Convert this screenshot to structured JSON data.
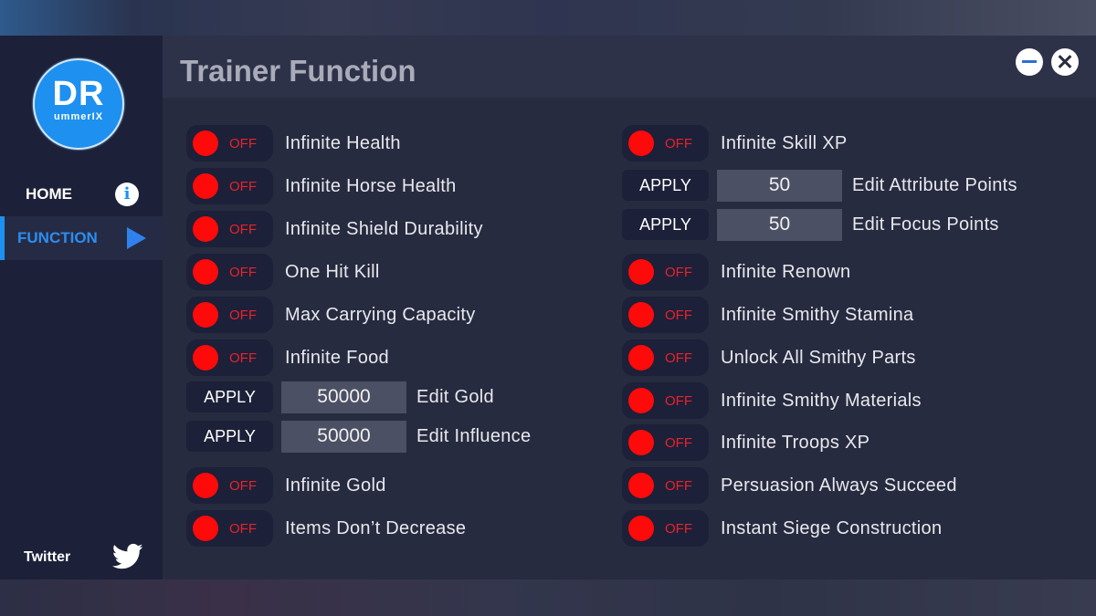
{
  "window": {
    "title": "Trainer Function",
    "minimize_icon": "minimize-icon",
    "close_icon": "close-icon"
  },
  "sidebar": {
    "logo": {
      "big": "DR",
      "small": "ummerIX"
    },
    "items": [
      {
        "label": "HOME",
        "icon": "info-icon",
        "icon_glyph": "i",
        "active": false
      },
      {
        "label": "FUNCTION",
        "icon": "play-icon",
        "active": true
      }
    ],
    "footer": {
      "label": "Twitter",
      "icon": "twitter-icon"
    }
  },
  "colors": {
    "accent": "#1e90f0",
    "toggle_off_knob": "#ff0a0a",
    "toggle_off_text": "#e8232b",
    "panel_bg": "#272b3f",
    "sidebar_bg": "#1c2038"
  },
  "left_column": [
    {
      "type": "toggle",
      "state": "OFF",
      "label": "Infinite Health"
    },
    {
      "type": "toggle",
      "state": "OFF",
      "label": "Infinite Horse Health"
    },
    {
      "type": "toggle",
      "state": "OFF",
      "label": "Infinite Shield Durability"
    },
    {
      "type": "toggle",
      "state": "OFF",
      "label": "One Hit Kill"
    },
    {
      "type": "toggle",
      "state": "OFF",
      "label": "Max Carrying Capacity"
    },
    {
      "type": "toggle",
      "state": "OFF",
      "label": "Infinite Food"
    },
    {
      "type": "edit",
      "button": "APPLY",
      "value": "50000",
      "label": "Edit Gold"
    },
    {
      "type": "edit",
      "button": "APPLY",
      "value": "50000",
      "label": "Edit Influence"
    },
    {
      "type": "toggle",
      "state": "OFF",
      "label": "Infinite Gold"
    },
    {
      "type": "toggle",
      "state": "OFF",
      "label": "Items Don’t Decrease"
    }
  ],
  "right_column": [
    {
      "type": "toggle",
      "state": "OFF",
      "label": "Infinite Skill XP"
    },
    {
      "type": "edit",
      "button": "APPLY",
      "value": "50",
      "label": "Edit Attribute Points"
    },
    {
      "type": "edit",
      "button": "APPLY",
      "value": "50",
      "label": "Edit Focus Points"
    },
    {
      "type": "toggle",
      "state": "OFF",
      "label": "Infinite Renown"
    },
    {
      "type": "toggle",
      "state": "OFF",
      "label": "Infinite Smithy Stamina"
    },
    {
      "type": "toggle",
      "state": "OFF",
      "label": "Unlock All Smithy Parts"
    },
    {
      "type": "toggle",
      "state": "OFF",
      "label": "Infinite Smithy Materials"
    },
    {
      "type": "toggle",
      "state": "OFF",
      "label": "Infinite Troops XP"
    },
    {
      "type": "toggle",
      "state": "OFF",
      "label": "Persuasion Always Succeed"
    },
    {
      "type": "toggle",
      "state": "OFF",
      "label": "Instant Siege Construction"
    }
  ]
}
